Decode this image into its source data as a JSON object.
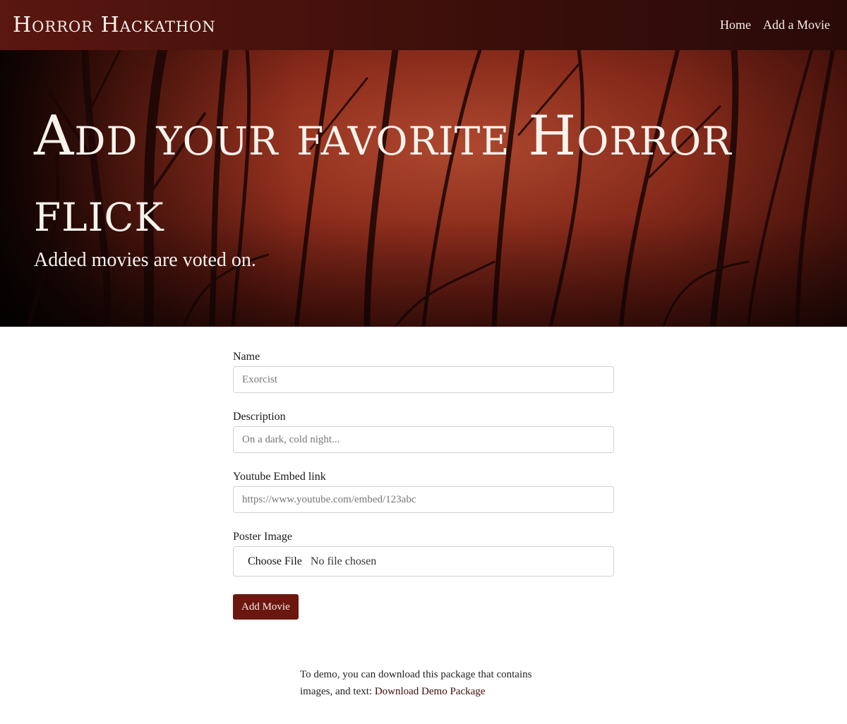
{
  "navbar": {
    "brand": "Horror Hackathon",
    "links": [
      {
        "label": "Home"
      },
      {
        "label": "Add a Movie"
      }
    ]
  },
  "hero": {
    "title": "Add your favorite Horror flick",
    "subtitle": "Added movies are voted on."
  },
  "form": {
    "fields": [
      {
        "label": "Name",
        "placeholder": "Exorcist"
      },
      {
        "label": "Description",
        "placeholder": "On a dark, cold night..."
      },
      {
        "label": "Youtube Embed link",
        "placeholder": "https://www.youtube.com/embed/123abc"
      }
    ],
    "poster": {
      "label": "Poster Image",
      "button": "Choose File",
      "status": "No file chosen"
    },
    "submit_label": "Add Movie"
  },
  "demo": {
    "text": "To demo, you can download this package that contains images, and text: ",
    "link_label": "Download Demo Package"
  },
  "colors": {
    "navbar": "#3a0e0a",
    "hero": "#8e2d1c",
    "button": "#6b1710"
  }
}
